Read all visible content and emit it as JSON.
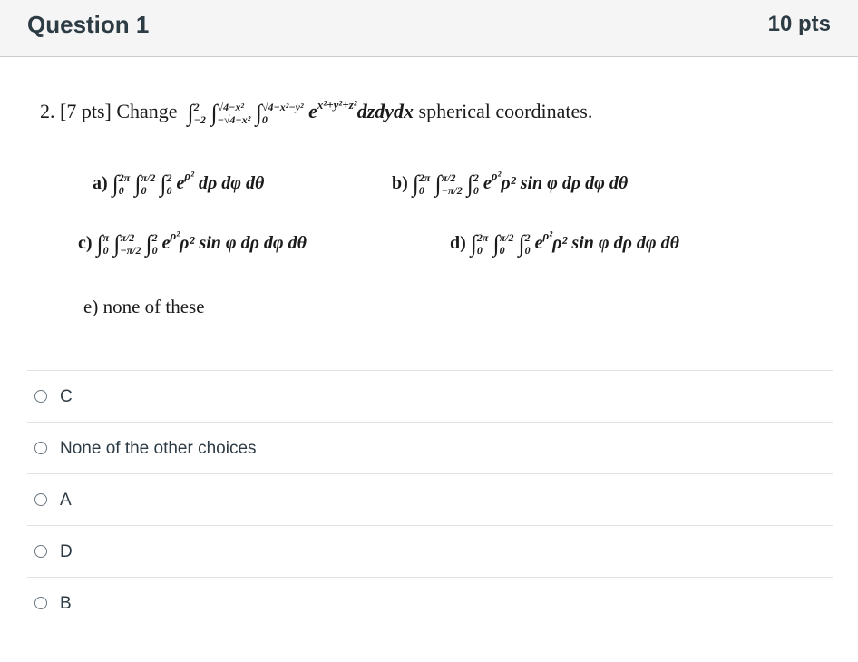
{
  "header": {
    "title": "Question 1",
    "points": "10 pts"
  },
  "question": {
    "prefix": "2. [7 pts]  Change",
    "int1_upper": "2",
    "int1_lower": "−2",
    "int2_upper": "√4−x²",
    "int2_lower": "−√4−x²",
    "int3_upper": "√4−x²−y²",
    "int3_lower": "0",
    "integrand": "e",
    "exponent": "x²+y²+z²",
    "differential": "dzdydx",
    "suffix": "spherical coordinates."
  },
  "choices": [
    {
      "label": "a)",
      "l1u": "2π",
      "l1l": "0",
      "l2u": "π/2",
      "l2l": "0",
      "l3u": "2",
      "l3l": "0",
      "body": "e",
      "exp": "ρ²",
      "rest": " dρ dφ dθ"
    },
    {
      "label": "b)",
      "l1u": "2π",
      "l1l": "0",
      "l2u": "π/2",
      "l2l": "−π/2",
      "l3u": "2",
      "l3l": "0",
      "body": "e",
      "exp": "ρ²",
      "rest": "ρ² sin φ dρ dφ dθ"
    },
    {
      "label": "c)",
      "l1u": "π",
      "l1l": "0",
      "l2u": "π/2",
      "l2l": "−π/2",
      "l3u": "2",
      "l3l": "0",
      "body": "e",
      "exp": "ρ²",
      "rest": "ρ² sin φ dρ dφ dθ"
    },
    {
      "label": "d)",
      "l1u": "2π",
      "l1l": "0",
      "l2u": "π/2",
      "l2l": "0",
      "l3u": "2",
      "l3l": "0",
      "body": "e",
      "exp": "ρ²",
      "rest": "ρ² sin φ dρ dφ dθ"
    },
    {
      "label": "e)",
      "text": "none of these"
    }
  ],
  "answers": [
    {
      "label": "C"
    },
    {
      "label": "None of the other choices"
    },
    {
      "label": "A"
    },
    {
      "label": "D"
    },
    {
      "label": "B"
    }
  ]
}
